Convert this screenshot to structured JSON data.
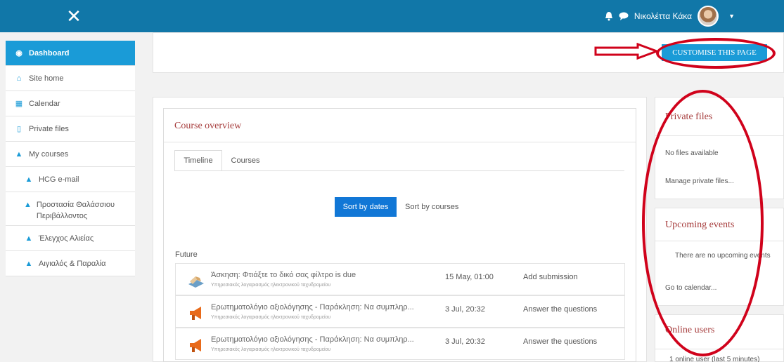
{
  "topbar": {
    "close_icon": "close-icon",
    "user_name": "Νικολέττα Κάκα",
    "accent": "#1177a8"
  },
  "sidebar": {
    "items": [
      {
        "label": "Dashboard",
        "icon": "dashboard-icon"
      },
      {
        "label": "Site home",
        "icon": "home-icon"
      },
      {
        "label": "Calendar",
        "icon": "calendar-icon"
      },
      {
        "label": "Private files",
        "icon": "file-icon"
      },
      {
        "label": "My courses",
        "icon": "graduation-cap-icon"
      },
      {
        "label": "HCG e-mail",
        "icon": "graduation-cap-icon"
      },
      {
        "label": "Προστασία Θαλάσσιου Περιβάλλοντος",
        "icon": "graduation-cap-icon"
      },
      {
        "label": "Έλεγχος Αλιείας",
        "icon": "graduation-cap-icon"
      },
      {
        "label": "Αιγιαλός & Παραλία",
        "icon": "graduation-cap-icon"
      }
    ]
  },
  "header": {
    "customise_label": "CUSTOMISE THIS PAGE"
  },
  "course_overview": {
    "title": "Course overview",
    "tabs": [
      {
        "label": "Timeline"
      },
      {
        "label": "Courses"
      }
    ],
    "sort_dates_label": "Sort by dates",
    "sort_courses_label": "Sort by courses",
    "section_label": "Future",
    "events": [
      {
        "name": "Άσκηση: Φτιάξτε το δικό σας φίλτρο is due",
        "course": "Υπηρεσιακός λογαριασμός ηλεκτρονικού ταχυδρομείου",
        "date": "15 May, 01:00",
        "action": "Add submission",
        "icon": "assignment-icon"
      },
      {
        "name": "Ερωτηματολόγιο αξιολόγησης - Παράκληση: Να συμπληρ...",
        "course": "Υπηρεσιακός λογαριασμός ηλεκτρονικού ταχυδρομείου",
        "date": "3 Jul, 20:32",
        "action": "Answer the questions",
        "icon": "megaphone-icon"
      },
      {
        "name": "Ερωτηματολόγιο αξιολόγησης - Παράκληση: Να συμπληρ...",
        "course": "Υπηρεσιακός λογαριασμός ηλεκτρονικού ταχυδρομείου",
        "date": "3 Jul, 20:32",
        "action": "Answer the questions",
        "icon": "megaphone-icon"
      }
    ]
  },
  "blocks": {
    "private_files": {
      "title": "Private files",
      "empty_text": "No files available",
      "manage_link": "Manage private files..."
    },
    "upcoming_events": {
      "title": "Upcoming events",
      "empty_text": "There are no upcoming events",
      "calendar_link": "Go to calendar..."
    },
    "online_users": {
      "title": "Online users",
      "summary": "1 online user (last 5 minutes)"
    }
  },
  "annotation_color": "#d0021b"
}
